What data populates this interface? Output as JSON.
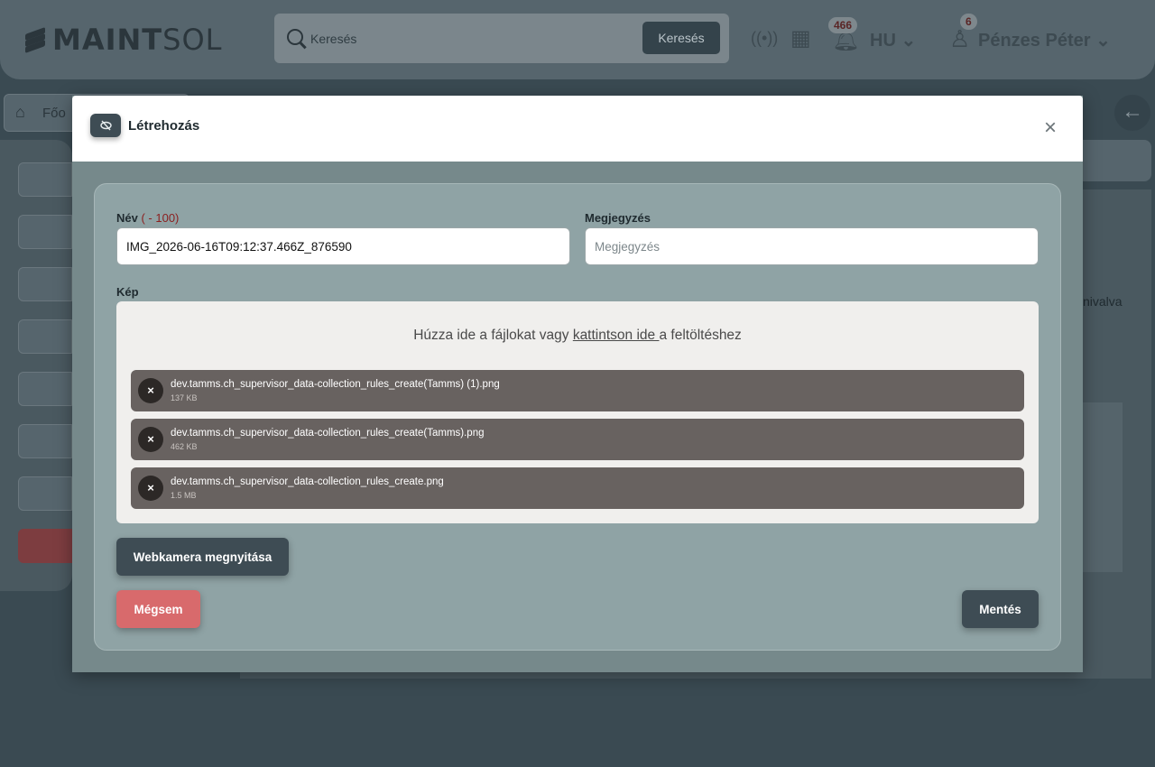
{
  "app": {
    "logo_bold": "MAINT",
    "logo_light": "SOL",
    "search_placeholder": "Keresés",
    "search_button": "Keresés",
    "notification_count": "466",
    "language": "HU",
    "user_badge": "6",
    "user_name": "Pénzes Péter",
    "breadcrumb_home": "Főo",
    "right_snippet": "nivalva"
  },
  "modal": {
    "title": "Létrehozás",
    "close_label": "×",
    "name_label": "Név",
    "name_limit": "( - 100)",
    "name_value": "IMG_2026-06-16T09:12:37.466Z_876590",
    "note_label": "Megjegyzés",
    "note_placeholder": "Megjegyzés",
    "image_label": "Kép",
    "drop_prefix": "Húzza ide a fájlokat vagy ",
    "drop_link": "kattintson ide ",
    "drop_suffix": "a feltöltéshez",
    "files": [
      {
        "name": "dev.tamms.ch_supervisor_data-collection_rules_create(Tamms) (1).png",
        "size": "137 KB"
      },
      {
        "name": "dev.tamms.ch_supervisor_data-collection_rules_create(Tamms).png",
        "size": "462 KB"
      },
      {
        "name": "dev.tamms.ch_supervisor_data-collection_rules_create.png",
        "size": "1.5 MB"
      }
    ],
    "remove_symbol": "×",
    "webcam_button": "Webkamera megnyitása",
    "cancel_button": "Mégsem",
    "save_button": "Mentés"
  },
  "colors": {
    "modal_body": "#8fa3a5",
    "dark_button": "#3e4c54",
    "cancel_button": "#d86a6c",
    "file_item": "#686260"
  }
}
